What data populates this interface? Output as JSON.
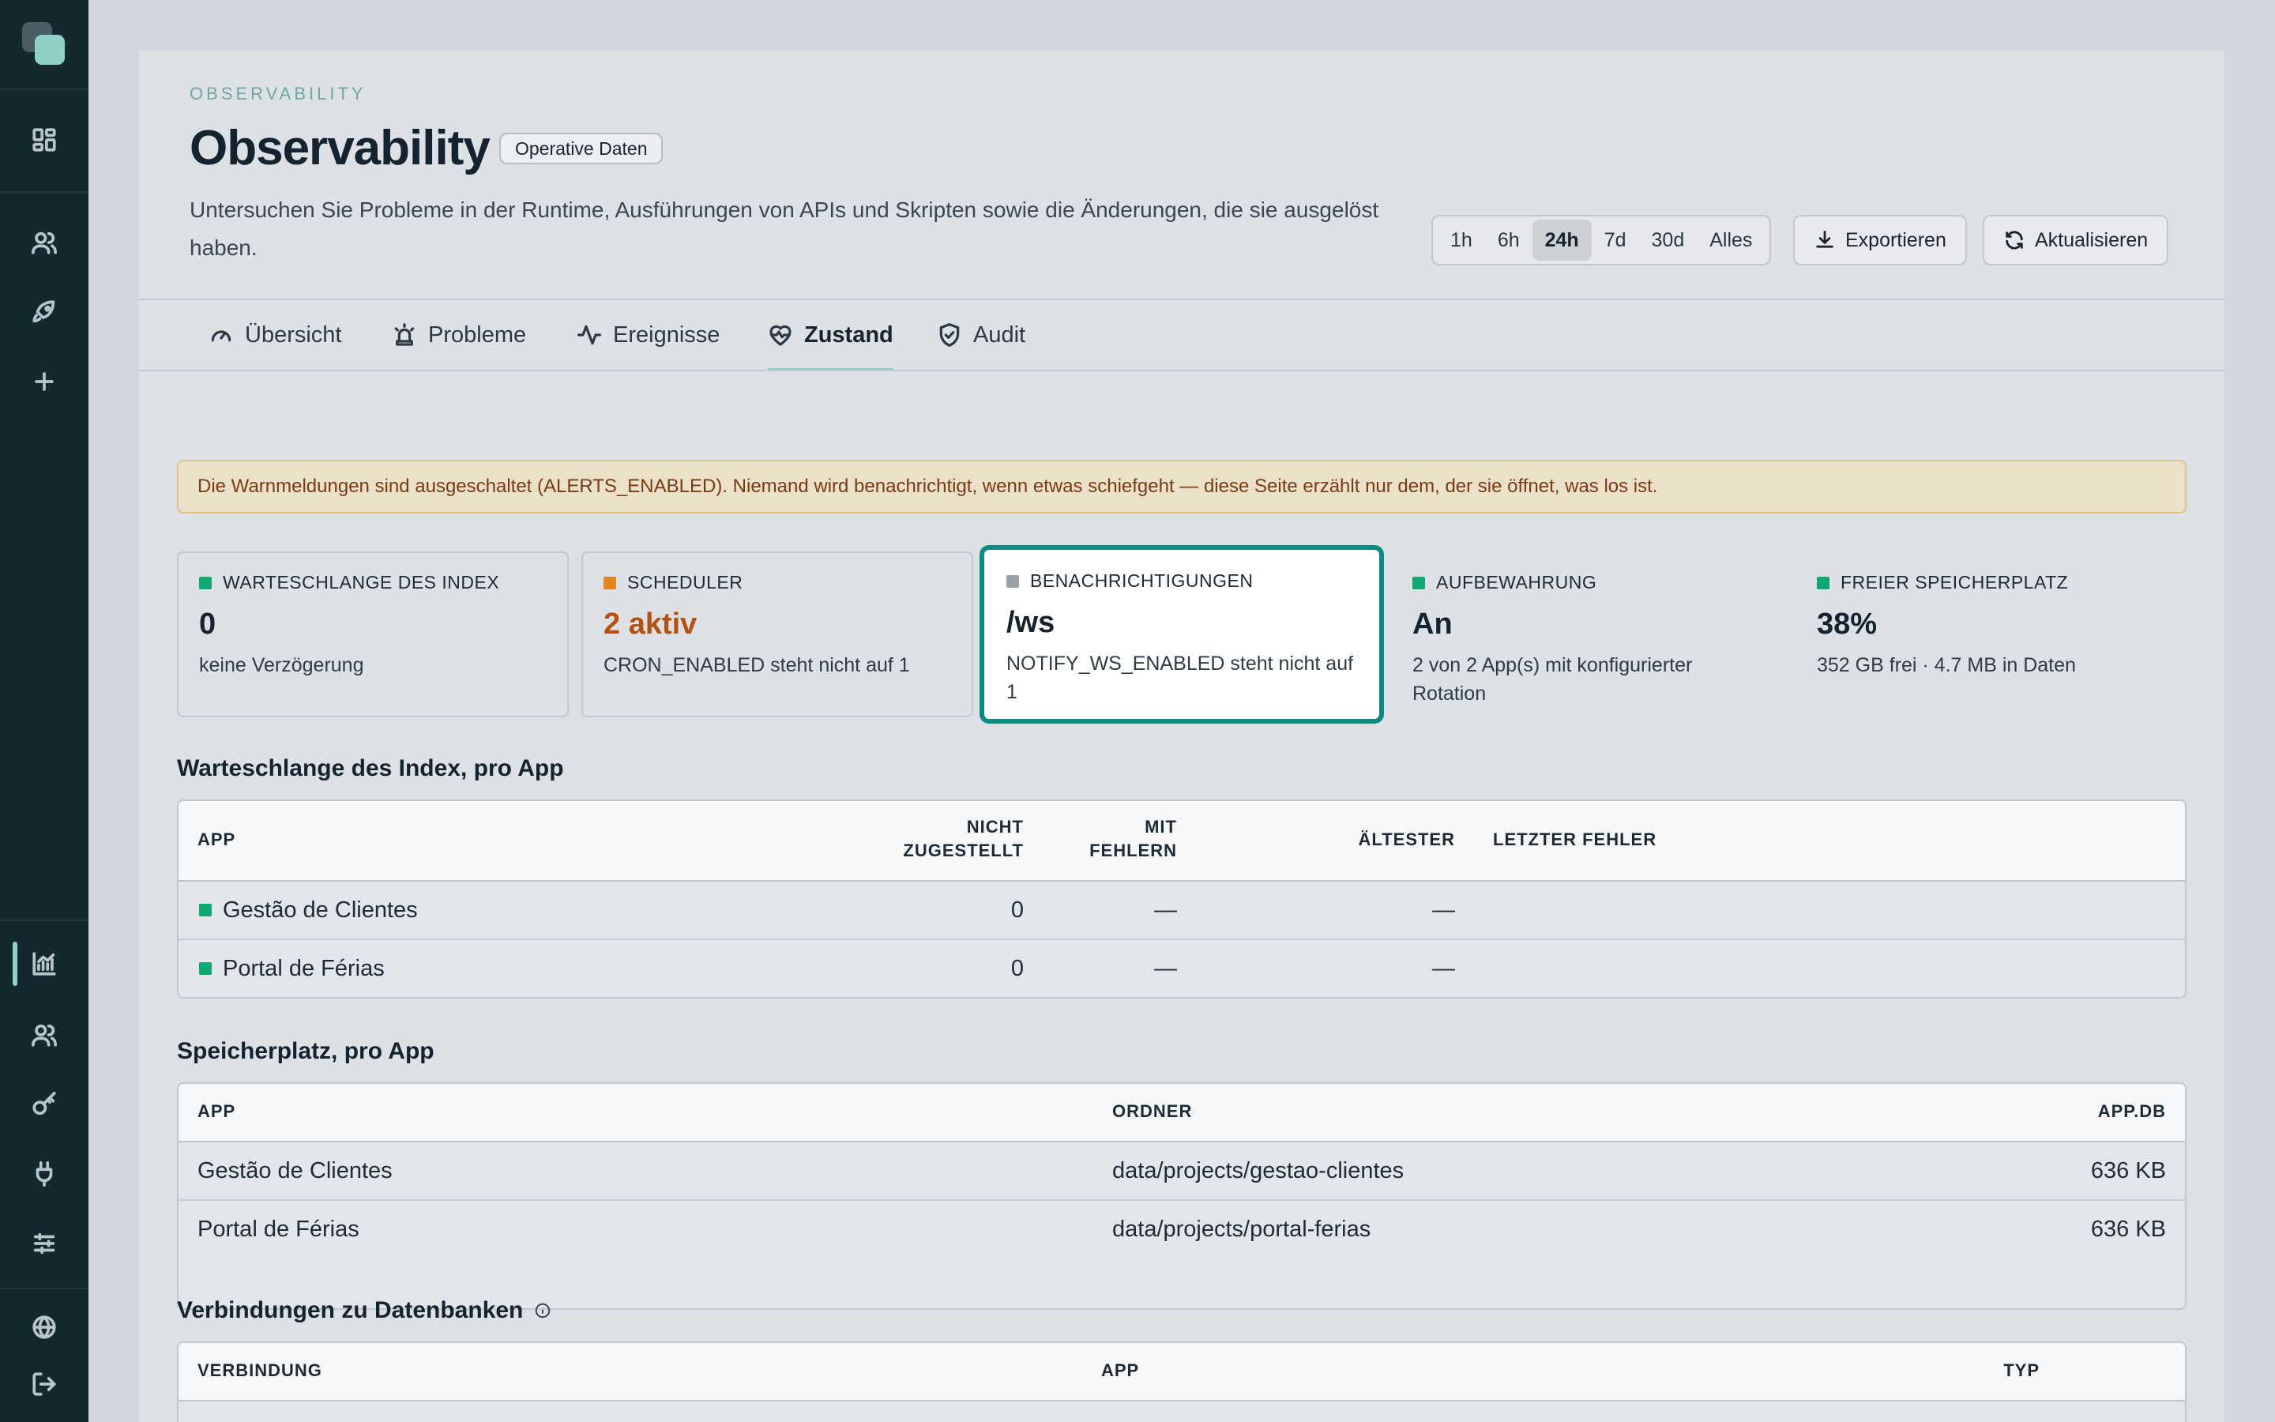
{
  "header": {
    "eyebrow": "OBSERVABILITY",
    "title": "Observability",
    "badge": "Operative Daten",
    "description": "Untersuchen Sie Probleme in der Runtime, Ausführungen von APIs und Skripten sowie die Änderungen, die sie ausgelöst haben."
  },
  "time_range": {
    "options": [
      "1h",
      "6h",
      "24h",
      "7d",
      "30d",
      "Alles"
    ],
    "selected": "24h"
  },
  "actions": {
    "export_label": "Exportieren",
    "refresh_label": "Aktualisieren"
  },
  "tabs": [
    {
      "label": "Übersicht",
      "icon": "gauge-icon"
    },
    {
      "label": "Probleme",
      "icon": "siren-icon"
    },
    {
      "label": "Ereignisse",
      "icon": "activity-icon"
    },
    {
      "label": "Zustand",
      "icon": "heart-pulse-icon",
      "active": true
    },
    {
      "label": "Audit",
      "icon": "shield-check-icon"
    }
  ],
  "alert": "Die Warnmeldungen sind ausgeschaltet (ALERTS_ENABLED). Niemand wird benachrichtigt, wenn etwas schiefgeht — diese Seite erzählt nur dem, der sie öffnet, was los ist.",
  "status_cards": [
    {
      "label": "WARTESCHLANGE DES INDEX",
      "value": "0",
      "sub": "keine Verzögerung",
      "color": "#12a874"
    },
    {
      "label": "SCHEDULER",
      "value": "2 aktiv",
      "sub": "CRON_ENABLED steht nicht auf 1",
      "color": "#e0881e",
      "value_color": "#b5500f"
    },
    {
      "label": "BENACHRICHTIGUNGEN",
      "value": "/ws",
      "sub": "NOTIFY_WS_ENABLED steht nicht auf 1",
      "color": "#9aa1a8"
    },
    {
      "label": "AUFBEWAHRUNG",
      "value": "An",
      "sub": "2 von 2 App(s) mit konfigurierter Rotation",
      "color": "#12a874"
    },
    {
      "label": "FREIER SPEICHERPLATZ",
      "value": "38%",
      "sub": "352 GB frei · 4.7 MB in Daten",
      "color": "#12a874"
    }
  ],
  "queue_section": {
    "title": "Warteschlange des Index, pro App",
    "headers": {
      "app": "APP",
      "undelivered_1": "NICHT",
      "undelivered_2": "ZUGESTELLT",
      "failed_1": "MIT",
      "failed_2": "FEHLERN",
      "oldest": "ÄLTESTER",
      "last_error": "LETZTER FEHLER"
    },
    "rows": [
      {
        "app": "Gestão de Clientes",
        "undelivered": "0",
        "failed": "—",
        "oldest": "—"
      },
      {
        "app": "Portal de Férias",
        "undelivered": "0",
        "failed": "—",
        "oldest": "—"
      }
    ]
  },
  "storage_section": {
    "title": "Speicherplatz, pro App",
    "headers": {
      "app": "APP",
      "folder": "ORDNER",
      "db": "APP.DB"
    },
    "rows": [
      {
        "app": "Gestão de Clientes",
        "folder": "data/projects/gestao-clientes",
        "db": "636 KB"
      },
      {
        "app": "Portal de Férias",
        "folder": "data/projects/portal-ferias",
        "db": "636 KB"
      }
    ]
  },
  "connections_section": {
    "title": "Verbindungen zu Datenbanken",
    "headers": {
      "connection": "VERBINDUNG",
      "app": "APP",
      "type": "TYP"
    }
  },
  "colors": {
    "accent": "#8fd2c4",
    "focus_ring": "#0c8c80",
    "ok": "#12a874",
    "warn": "#e0881e",
    "sidebar": "#13282f"
  }
}
